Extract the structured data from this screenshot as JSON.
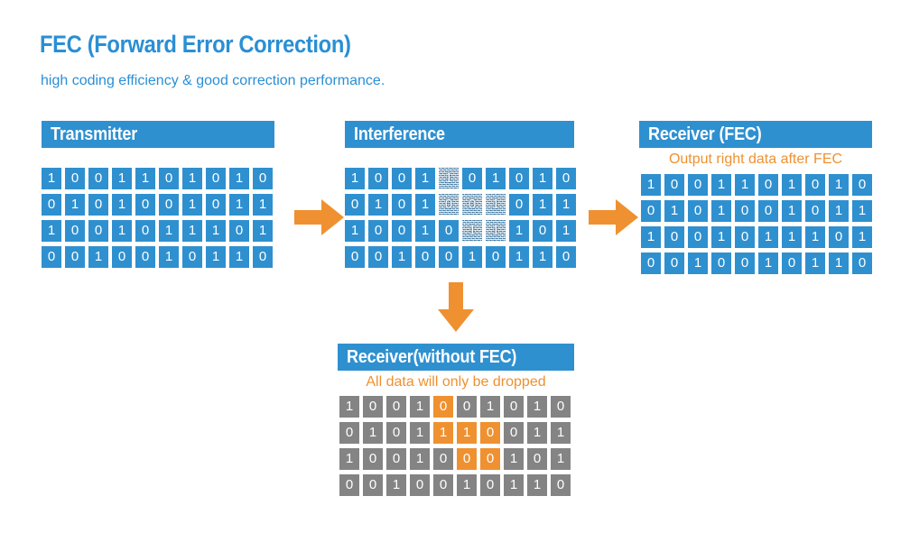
{
  "page": {
    "title": "FEC (Forward Error Correction)",
    "subtitle": "high coding efficiency & good correction performance.",
    "title_color": "#2a8fd4",
    "accent_blue": "#2f90d0",
    "accent_orange": "#ef9130",
    "grey": "#848484",
    "background": "#ffffff"
  },
  "panels": {
    "transmitter": {
      "header": "Transmitter",
      "note": "",
      "rows": [
        [
          "1",
          "0",
          "0",
          "1",
          "1",
          "0",
          "1",
          "0",
          "1",
          "0"
        ],
        [
          "0",
          "1",
          "0",
          "1",
          "0",
          "0",
          "1",
          "0",
          "1",
          "1"
        ],
        [
          "1",
          "0",
          "0",
          "1",
          "0",
          "1",
          "1",
          "1",
          "0",
          "1"
        ],
        [
          "0",
          "0",
          "1",
          "0",
          "0",
          "1",
          "0",
          "1",
          "1",
          "0"
        ]
      ],
      "noise_cells": [],
      "highlight_cells": []
    },
    "interference": {
      "header": "Interference",
      "note": "",
      "rows": [
        [
          "1",
          "0",
          "0",
          "1",
          "1",
          "0",
          "1",
          "0",
          "1",
          "0"
        ],
        [
          "0",
          "1",
          "0",
          "1",
          "0",
          "0",
          "1",
          "0",
          "1",
          "1"
        ],
        [
          "1",
          "0",
          "0",
          "1",
          "0",
          "1",
          "1",
          "1",
          "0",
          "1"
        ],
        [
          "0",
          "0",
          "1",
          "0",
          "0",
          "1",
          "0",
          "1",
          "1",
          "0"
        ]
      ],
      "noise_cells": [
        [
          0,
          4
        ],
        [
          1,
          4
        ],
        [
          1,
          5
        ],
        [
          1,
          6
        ],
        [
          2,
          5
        ],
        [
          2,
          6
        ]
      ],
      "highlight_cells": []
    },
    "receiver_fec": {
      "header": "Receiver (FEC)",
      "note": "Output right data after FEC",
      "rows": [
        [
          "1",
          "0",
          "0",
          "1",
          "1",
          "0",
          "1",
          "0",
          "1",
          "0"
        ],
        [
          "0",
          "1",
          "0",
          "1",
          "0",
          "0",
          "1",
          "0",
          "1",
          "1"
        ],
        [
          "1",
          "0",
          "0",
          "1",
          "0",
          "1",
          "1",
          "1",
          "0",
          "1"
        ],
        [
          "0",
          "0",
          "1",
          "0",
          "0",
          "1",
          "0",
          "1",
          "1",
          "0"
        ]
      ],
      "noise_cells": [],
      "highlight_cells": []
    },
    "receiver_without_fec": {
      "header": "Receiver(without FEC)",
      "note": "All data will only be dropped",
      "rows": [
        [
          "1",
          "0",
          "0",
          "1",
          "0",
          "0",
          "1",
          "0",
          "1",
          "0"
        ],
        [
          "0",
          "1",
          "0",
          "1",
          "1",
          "1",
          "0",
          "0",
          "1",
          "1"
        ],
        [
          "1",
          "0",
          "0",
          "1",
          "0",
          "0",
          "0",
          "1",
          "0",
          "1"
        ],
        [
          "0",
          "0",
          "1",
          "0",
          "0",
          "1",
          "0",
          "1",
          "1",
          "0"
        ]
      ],
      "noise_cells": [],
      "highlight_cells": [
        [
          0,
          4
        ],
        [
          1,
          4
        ],
        [
          1,
          5
        ],
        [
          1,
          6
        ],
        [
          2,
          5
        ],
        [
          2,
          6
        ]
      ]
    }
  },
  "arrows": [
    {
      "name": "arrow-transmitter-to-interference",
      "direction": "right"
    },
    {
      "name": "arrow-interference-to-receiver-fec",
      "direction": "right"
    },
    {
      "name": "arrow-interference-to-receiver-without-fec",
      "direction": "down"
    }
  ]
}
